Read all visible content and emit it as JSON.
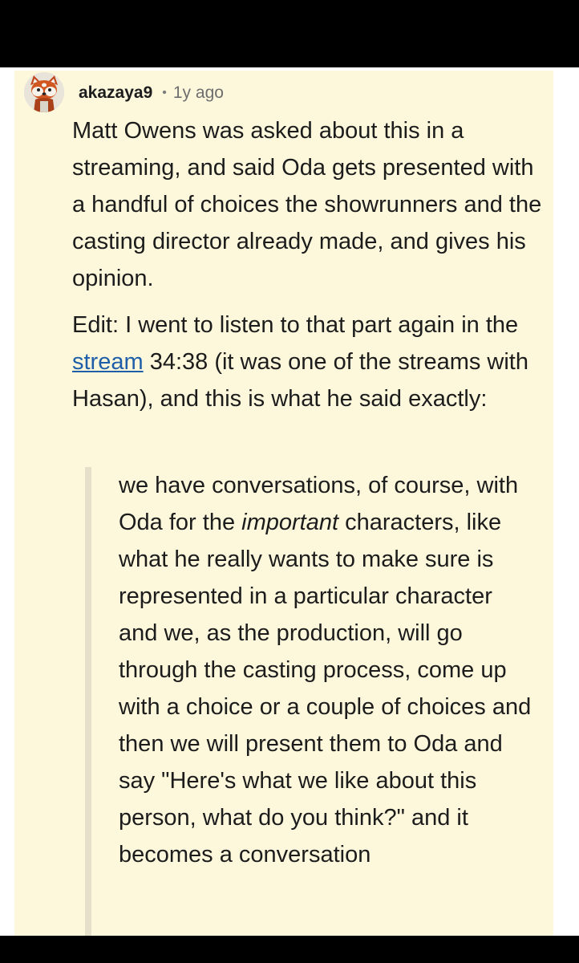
{
  "comment": {
    "author": "akazaya9",
    "separator": "•",
    "age": "1y ago",
    "paragraph1": "Matt Owens was asked about this in a streaming, and said Oda gets presented with a handful of choices the showrunners and the casting director already made, and gives his opinion.",
    "paragraph2_before": "Edit: I went to listen to that part again in the ",
    "paragraph2_link": "stream",
    "paragraph2_after": " 34:38 (it was one of the streams with Hasan), and this is what he said exactly:",
    "quote_before": "we have conversations, of course, with Oda for the ",
    "quote_emphasis": "important",
    "quote_after": " characters, like what he really wants to make sure is represented in a particular character and we, as the production, will go through the casting process, come up with a choice or a couple of choices and then we will present them to Oda and say \"Here's what we like about this person, what do you think?\" and it becomes a conversation"
  },
  "icons": {
    "avatar": "red-panda-avatar-icon"
  },
  "colors": {
    "card_background": "#fdf8dc",
    "link": "#1f5ea8",
    "quote_bar": "#e4e0c9"
  }
}
